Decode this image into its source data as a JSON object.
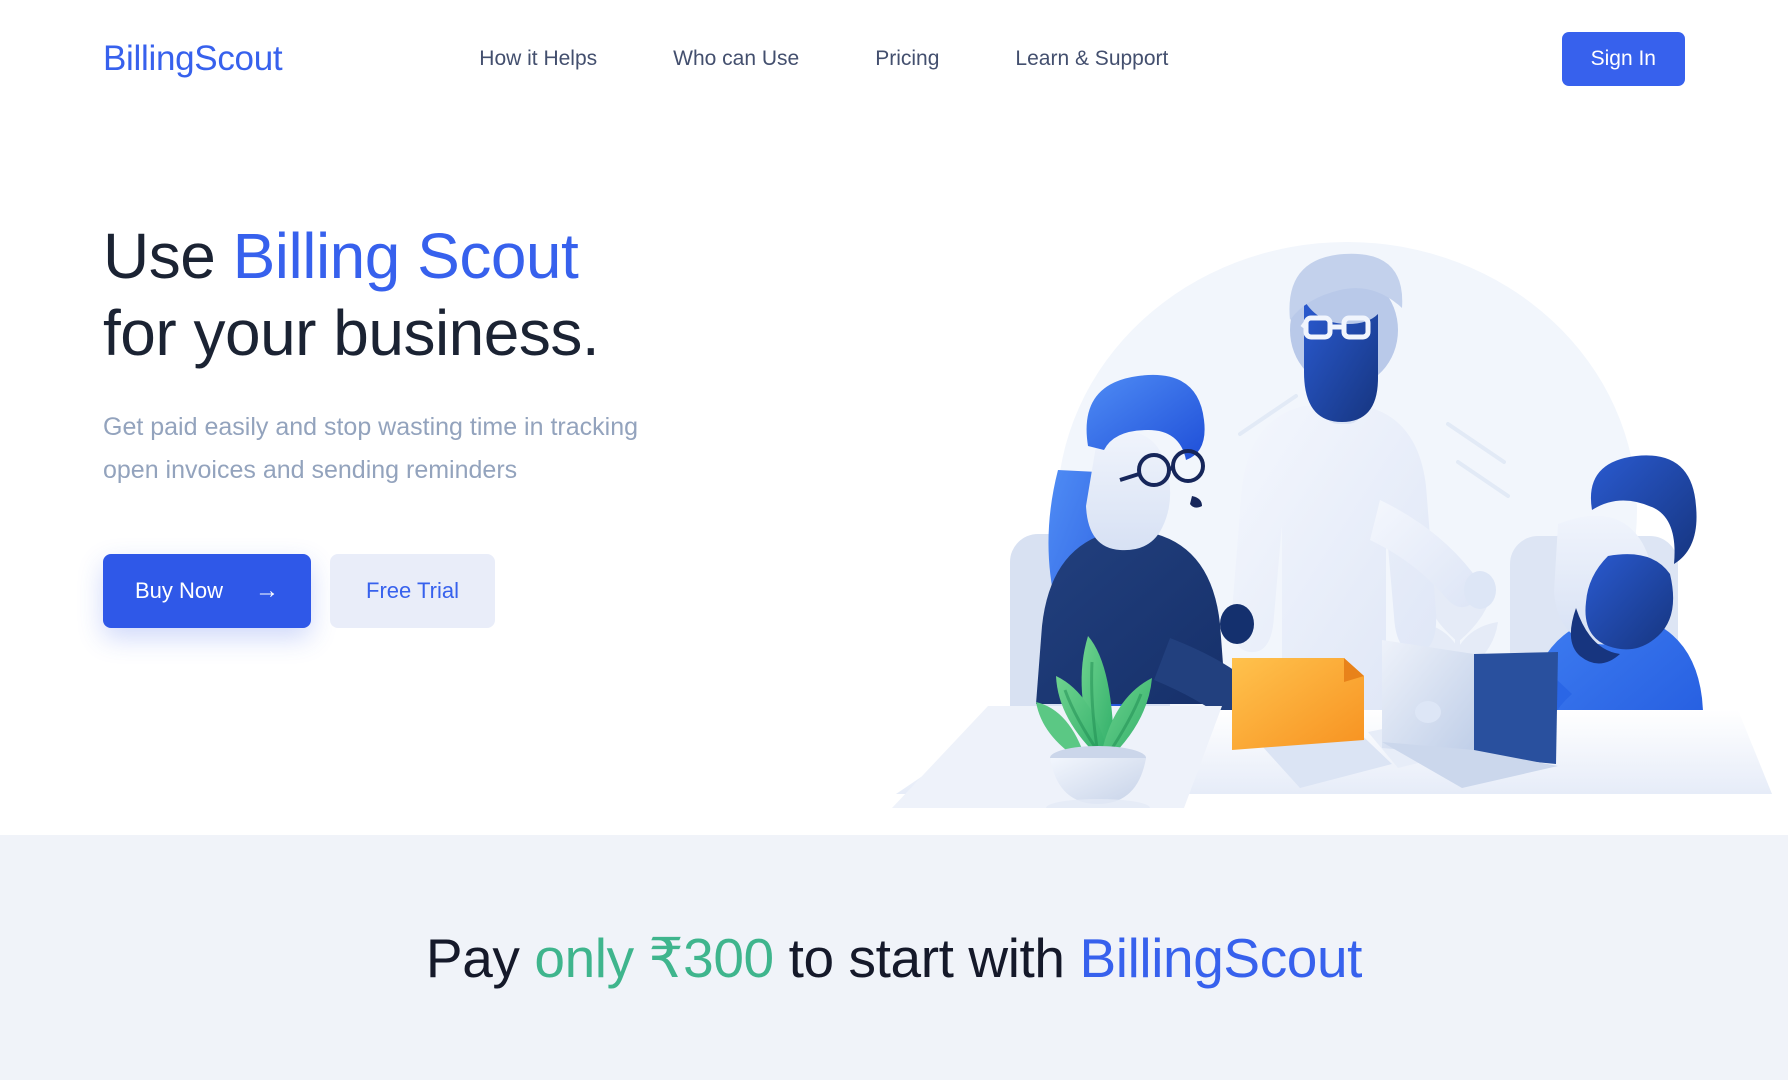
{
  "brand": {
    "name": "BillingScout",
    "primary_color": "#3761ed",
    "accent_green": "#3fb58d",
    "dark_text": "#1b2333",
    "muted_text": "#93a3bd"
  },
  "header": {
    "logo": "BillingScout",
    "nav": [
      {
        "label": "How it Helps"
      },
      {
        "label": "Who can Use"
      },
      {
        "label": "Pricing"
      },
      {
        "label": "Learn & Support"
      }
    ],
    "signin_label": "Sign In"
  },
  "hero": {
    "headline_part1": "Use ",
    "headline_accent": "Billing Scout",
    "headline_part2": "for your business.",
    "subhead_line1": "Get paid easily and stop wasting time in tracking",
    "subhead_line2": "open invoices and sending reminders",
    "buy_label": "Buy Now",
    "buy_arrow": "→",
    "trial_label": "Free Trial",
    "illustration_name": "team-meeting-illustration"
  },
  "band": {
    "text_part1": "Pay ",
    "text_green": "only ₹300",
    "text_part2": " to start with ",
    "text_blue": "BillingScout"
  }
}
